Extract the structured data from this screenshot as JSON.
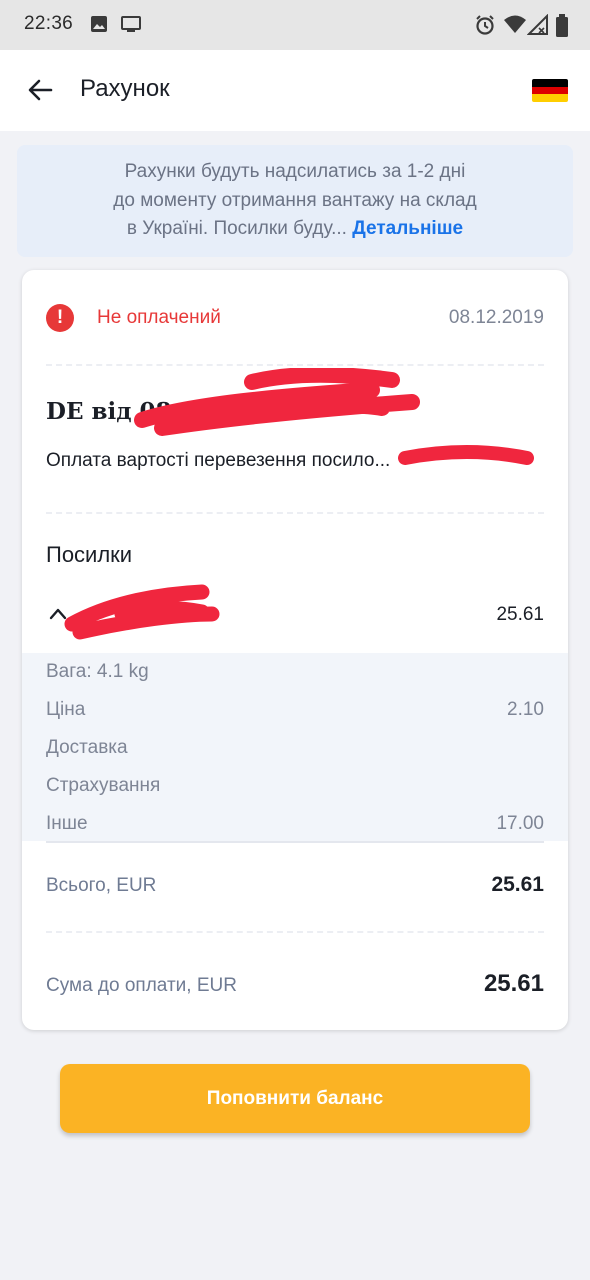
{
  "status_bar": {
    "time": "22:36",
    "left_icons": [
      "image-icon",
      "cast-icon"
    ],
    "right_icons": [
      "alarm-icon",
      "wifi-icon",
      "signal-icon",
      "battery-icon"
    ]
  },
  "header": {
    "title": "Рахунок",
    "back_icon": "arrow-left-icon",
    "flag": "flag-germany",
    "flag_colors": [
      "#000000",
      "#dd0000",
      "#ffce00"
    ]
  },
  "info_banner": {
    "text_line1": "Рахунки будуть надсилатись за 1-2 дні",
    "text_line2": "до  моменту отримання вантажу на склад",
    "text_line3": "в Україні. Посилки буду...",
    "link": "Детальніше"
  },
  "invoice": {
    "status": "Не оплачений",
    "date": "08.12.2019",
    "shipment_title": "DE від 08.12...",
    "shipment_description": "Оплата вартості перевезення посило...",
    "parcels_heading": "Посилки",
    "parcel": {
      "total": "25.61",
      "details": [
        {
          "label": "Вага: 4.1 kg",
          "value": ""
        },
        {
          "label": "Ціна",
          "value": "2.10"
        },
        {
          "label": "Доставка",
          "value": ""
        },
        {
          "label": "Страхування",
          "value": ""
        },
        {
          "label": "Інше",
          "value": "17.00"
        }
      ]
    },
    "total_label": "Всього, EUR",
    "total_value": "25.61",
    "due_label": "Сума до оплати, EUR",
    "due_value": "25.61"
  },
  "topup_button": "Поповнити баланс",
  "colors": {
    "accent": "#fbb324",
    "link": "#1a73e8",
    "error": "#e73838",
    "redaction": "#f0263e"
  }
}
